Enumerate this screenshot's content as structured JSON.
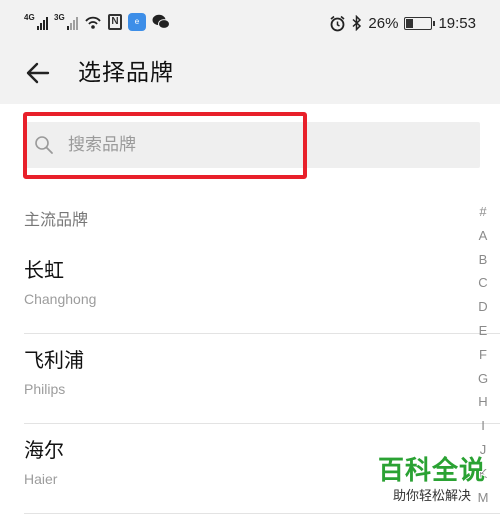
{
  "status_bar": {
    "sim1_network": "4G",
    "sim2_network": "3G",
    "nfc_label": "N",
    "app_badge_label": "e",
    "battery_percent": "26%",
    "battery_level": 0.26,
    "time": "19:53",
    "icons": [
      "signal-icon",
      "signal-icon",
      "wifi-icon",
      "nfc-icon",
      "app-badge-icon",
      "wechat-icon",
      "alarm-icon",
      "bluetooth-icon",
      "battery-icon"
    ]
  },
  "header": {
    "title": "选择品牌",
    "back_icon": "arrow-left-icon"
  },
  "search": {
    "placeholder": "搜索品牌",
    "icon": "search-icon",
    "highlight_color": "#e8202a"
  },
  "section_title": "主流品牌",
  "brands": [
    {
      "name": "长虹",
      "pinyin": "Changhong"
    },
    {
      "name": "飞利浦",
      "pinyin": "Philips"
    },
    {
      "name": "海尔",
      "pinyin": "Haier"
    }
  ],
  "index_letters": [
    "#",
    "A",
    "B",
    "C",
    "D",
    "E",
    "F",
    "G",
    "H",
    "I",
    "J",
    "K",
    "M"
  ],
  "watermark": {
    "title": "百科全说",
    "subtitle": "助你轻松解决",
    "color": "#2aa233"
  }
}
